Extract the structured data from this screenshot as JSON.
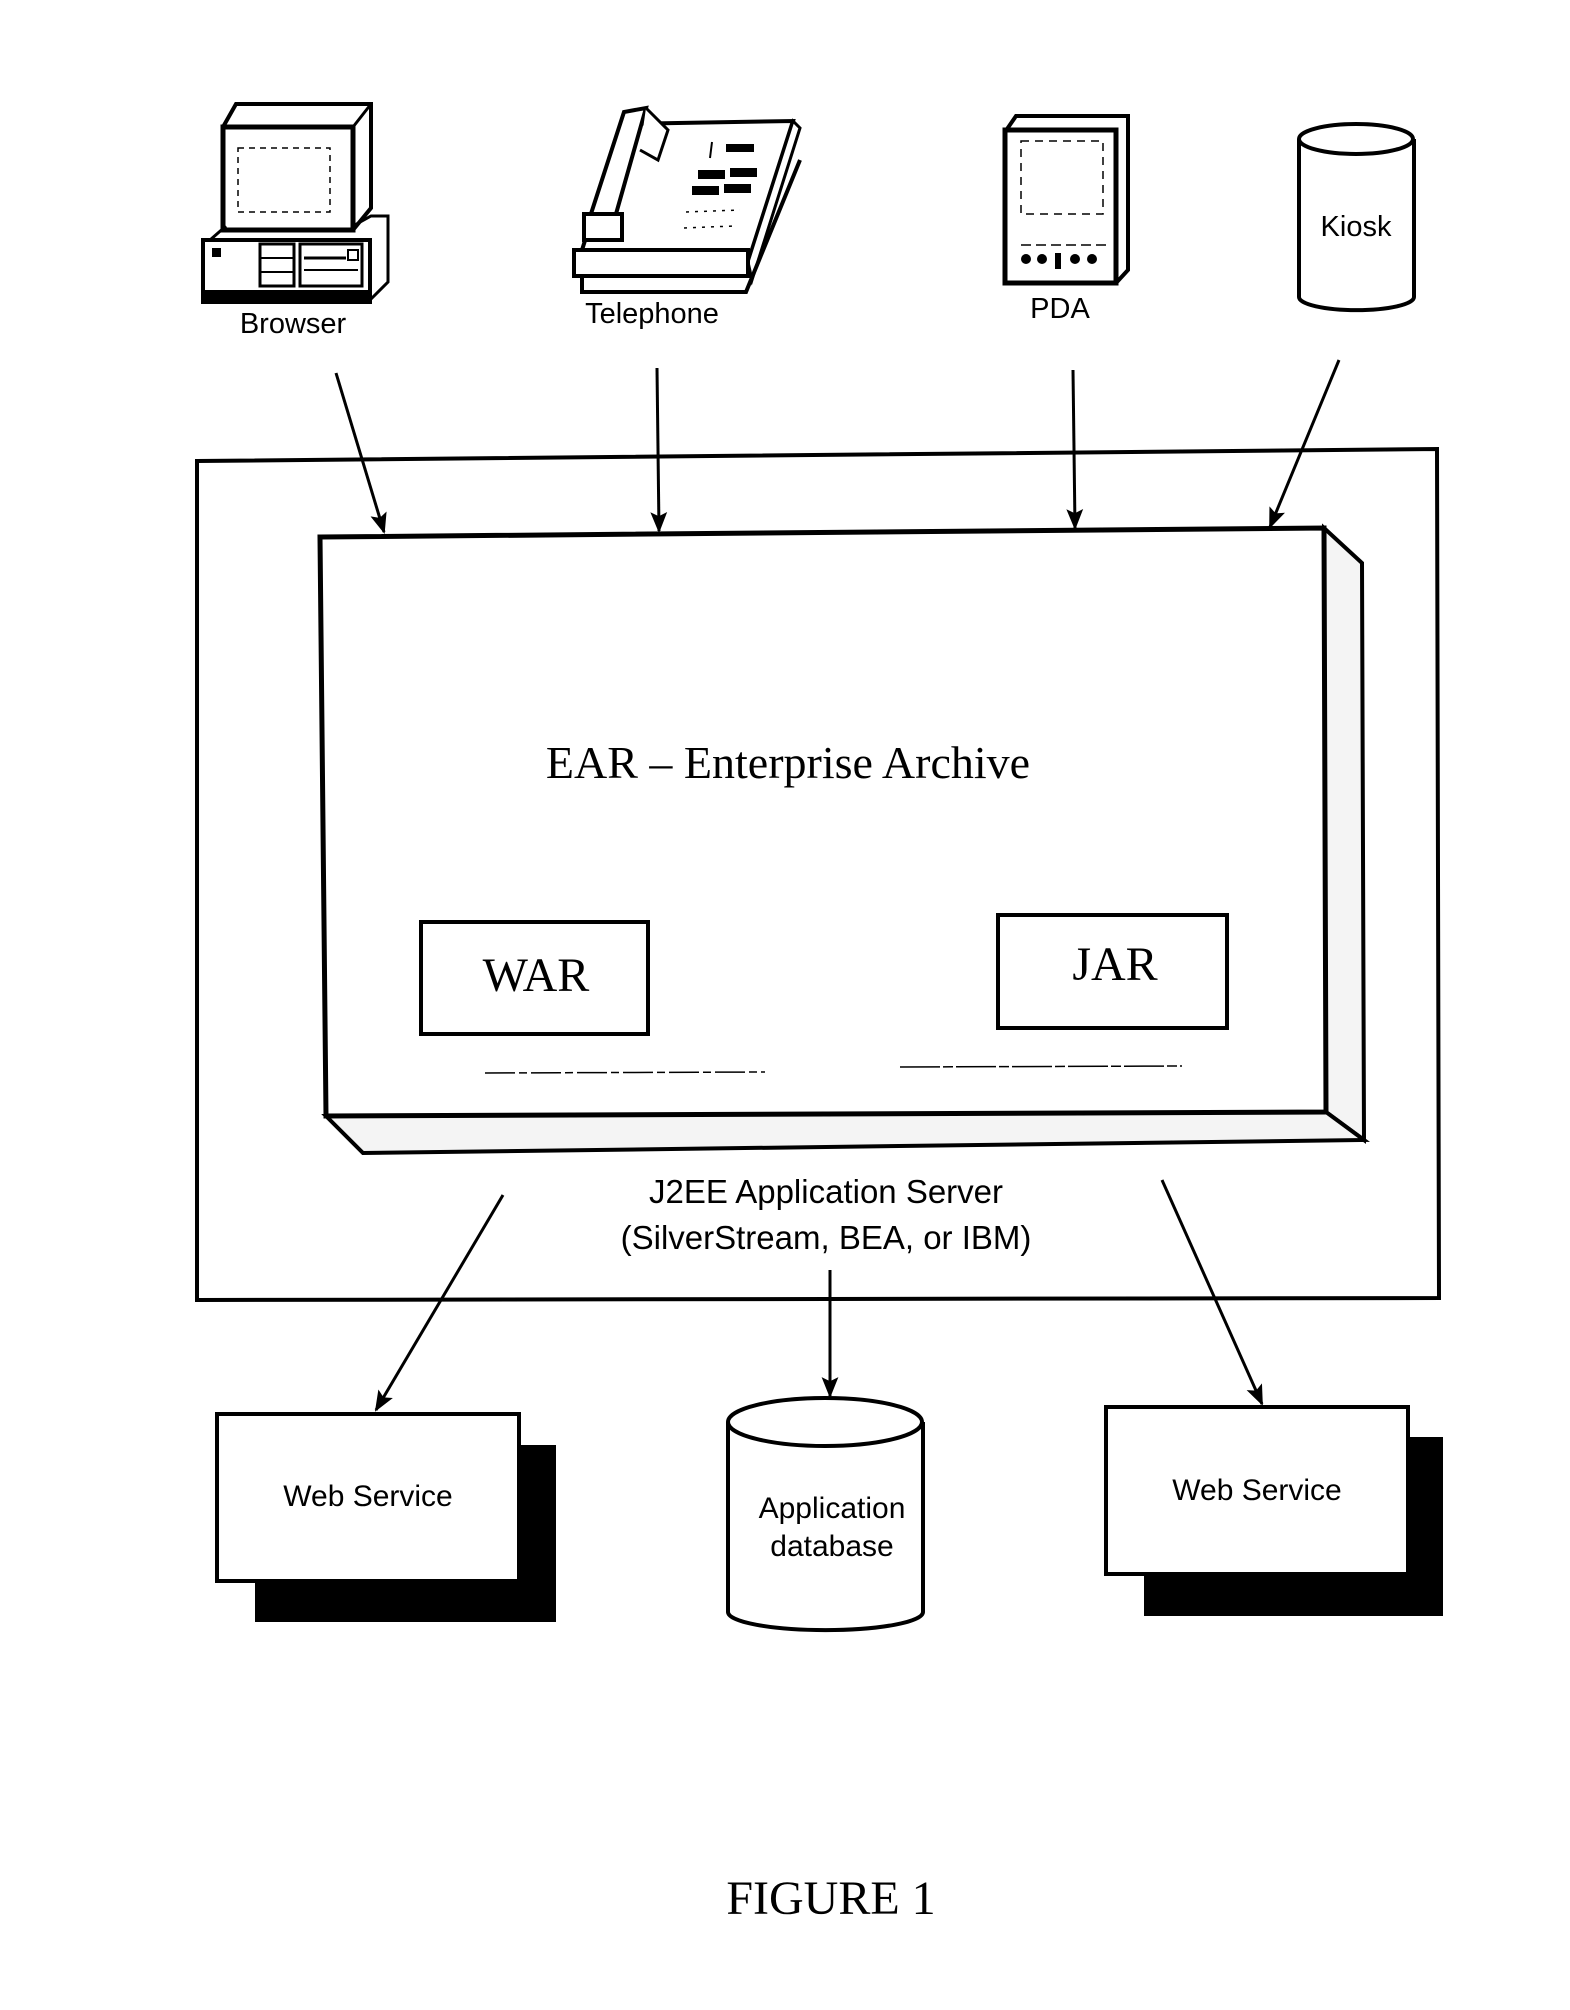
{
  "figure": {
    "caption": "FIGURE 1",
    "colors": {
      "ink": "#000000",
      "paper": "#ffffff",
      "slab_shade": "#f4f4f4"
    }
  },
  "clients": [
    {
      "id": "browser",
      "label": "Browser",
      "icon": "desktop-computer-icon"
    },
    {
      "id": "telephone",
      "label": "Telephone",
      "icon": "desk-telephone-icon"
    },
    {
      "id": "pda",
      "label": "PDA",
      "icon": "pda-handheld-icon"
    },
    {
      "id": "kiosk",
      "label": "Kiosk",
      "icon": "cylinder-icon"
    }
  ],
  "server": {
    "title_line1": "J2EE Application Server",
    "title_line2": "(SilverStream, BEA, or IBM)"
  },
  "ear": {
    "title": "EAR – Enterprise Archive",
    "modules": [
      {
        "id": "war",
        "label": "WAR"
      },
      {
        "id": "jar",
        "label": "JAR"
      }
    ]
  },
  "backends": [
    {
      "id": "web-service-left",
      "label": "Web Service"
    },
    {
      "id": "app-database",
      "label_line1": "Application",
      "label_line2": "database"
    },
    {
      "id": "web-service-right",
      "label": "Web Service"
    }
  ],
  "connections": [
    {
      "from": "Browser",
      "to": "EAR – Enterprise Archive"
    },
    {
      "from": "Telephone",
      "to": "EAR – Enterprise Archive"
    },
    {
      "from": "PDA",
      "to": "EAR – Enterprise Archive"
    },
    {
      "from": "Kiosk",
      "to": "EAR – Enterprise Archive"
    },
    {
      "from": "J2EE Application Server",
      "to": "Web Service (left)"
    },
    {
      "from": "J2EE Application Server",
      "to": "Application database"
    },
    {
      "from": "J2EE Application Server",
      "to": "Web Service (right)"
    }
  ]
}
